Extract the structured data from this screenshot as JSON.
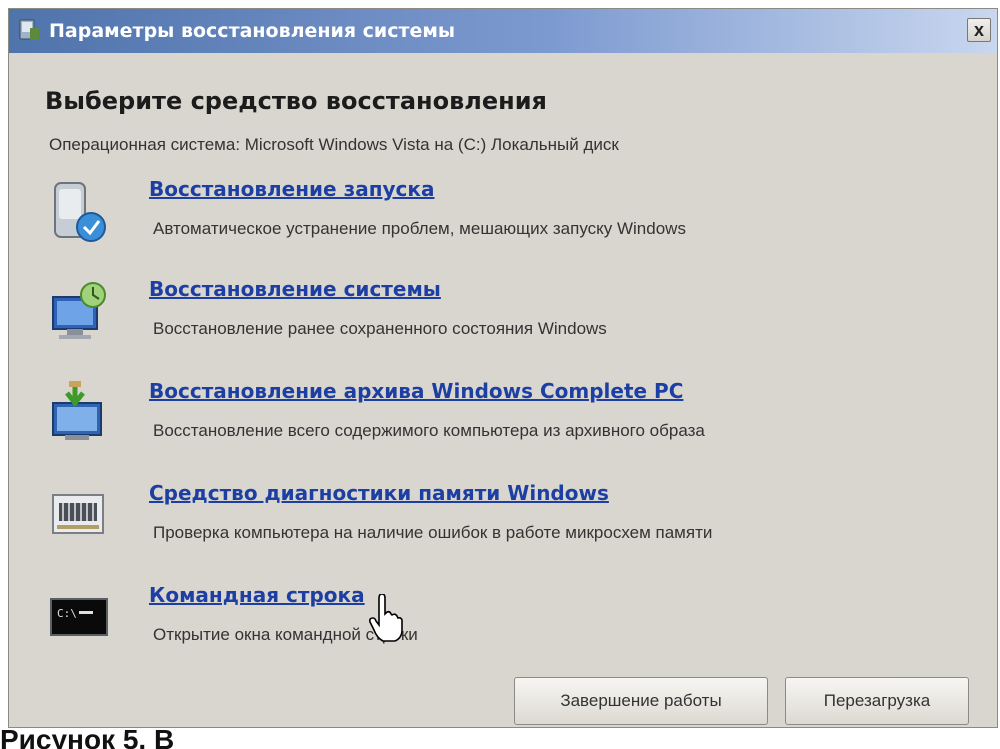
{
  "window": {
    "title": "Параметры восстановления системы",
    "close_label": "x"
  },
  "heading": "Выберите средство восстановления",
  "os_line": "Операционная система: Microsoft Windows Vista на (C:) Локальный диск",
  "tools": [
    {
      "link": "Восстановление запуска",
      "desc": "Автоматическое устранение проблем, мешающих запуску Windows",
      "icon": "startup-repair-icon"
    },
    {
      "link": "Восстановление системы",
      "desc": "Восстановление ранее сохраненного состояния Windows",
      "icon": "system-restore-icon"
    },
    {
      "link": "Восстановление архива Windows Complete PC",
      "desc": "Восстановление всего содержимого компьютера из архивного образа",
      "icon": "complete-pc-restore-icon"
    },
    {
      "link": "Средство диагностики памяти Windows",
      "desc": "Проверка компьютера на наличие ошибок в работе микросхем памяти",
      "icon": "memory-chip-icon"
    },
    {
      "link": "Командная строка",
      "desc": "Открытие окна командной строки",
      "icon": "command-prompt-icon"
    }
  ],
  "buttons": {
    "shutdown": "Завершение работы",
    "restart": "Перезагрузка"
  },
  "caption": "Рисунок 5. В"
}
